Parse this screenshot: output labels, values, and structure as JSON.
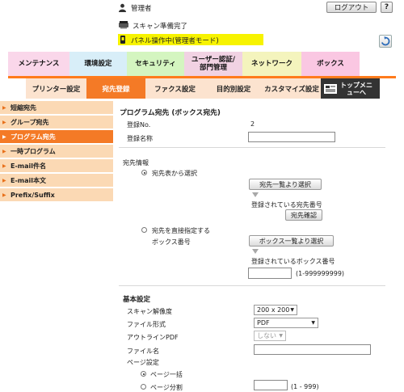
{
  "header": {
    "admin_label": "管理者",
    "logout_label": "ログアウト",
    "help_label": "?",
    "status_text": "スキャン準備完了",
    "mode_text": "パネル操作中(管理者モード)"
  },
  "top_tabs": [
    {
      "label": "メンテナンス",
      "color": "#fad7ea"
    },
    {
      "label": "環境設定",
      "color": "#d8eef8"
    },
    {
      "label": "セキュリティ",
      "color": "#d4f5c0"
    },
    {
      "label": "ユーザー認証/部門管理",
      "color": "#f1d2e3"
    },
    {
      "label": "ネットワーク",
      "color": "#f4f4bd"
    },
    {
      "label": "ボックス",
      "color": "#fac7e2"
    }
  ],
  "sub_tabs": [
    {
      "label": "プリンター設定"
    },
    {
      "label": "宛先登録",
      "active": true
    },
    {
      "label": "ファクス設定"
    },
    {
      "label": "目的別設定"
    },
    {
      "label": "カスタマイズ設定"
    },
    {
      "label": "トップメニューへ"
    }
  ],
  "sidebar": {
    "items": [
      {
        "label": "短縮宛先"
      },
      {
        "label": "グループ宛先"
      },
      {
        "label": "プログラム宛先",
        "active": true
      },
      {
        "label": "一時プログラム"
      },
      {
        "label": "E-mail件名"
      },
      {
        "label": "E-mail本文"
      },
      {
        "label": "Prefix/Suffix"
      }
    ]
  },
  "main": {
    "title": "プログラム宛先 (ボックス宛先)",
    "reg_no_label": "登録No.",
    "reg_no_value": "2",
    "reg_name_label": "登録名称",
    "reg_name_value": "",
    "dest_info_label": "宛先情報",
    "select_from_list_label": "宛先表から選択",
    "dest_list_button": "宛先一覧より選択",
    "registered_dest_label": "登録されている宛先番号",
    "dest_confirm_button": "宛先確認",
    "direct_label": "宛先を直接指定する",
    "box_no_label": "ボックス番号",
    "box_list_button": "ボックス一覧より選択",
    "registered_box_label": "登録されているボックス番号",
    "box_no_value": "",
    "box_range": "(1-999999999)",
    "basic_settings_label": "基本設定",
    "scan_res_label": "スキャン解像度",
    "scan_res_value": "200 x 200",
    "file_format_label": "ファイル形式",
    "file_format_value": "PDF",
    "outline_pdf_label": "アウトラインPDF",
    "outline_pdf_value": "しない",
    "file_name_label": "ファイル名",
    "file_name_value": "",
    "page_settings_label": "ページ設定",
    "page_batch_label": "ページ一括",
    "page_split_label": "ページ分割",
    "page_split_value": "",
    "page_range": "(1 - 999)"
  }
}
